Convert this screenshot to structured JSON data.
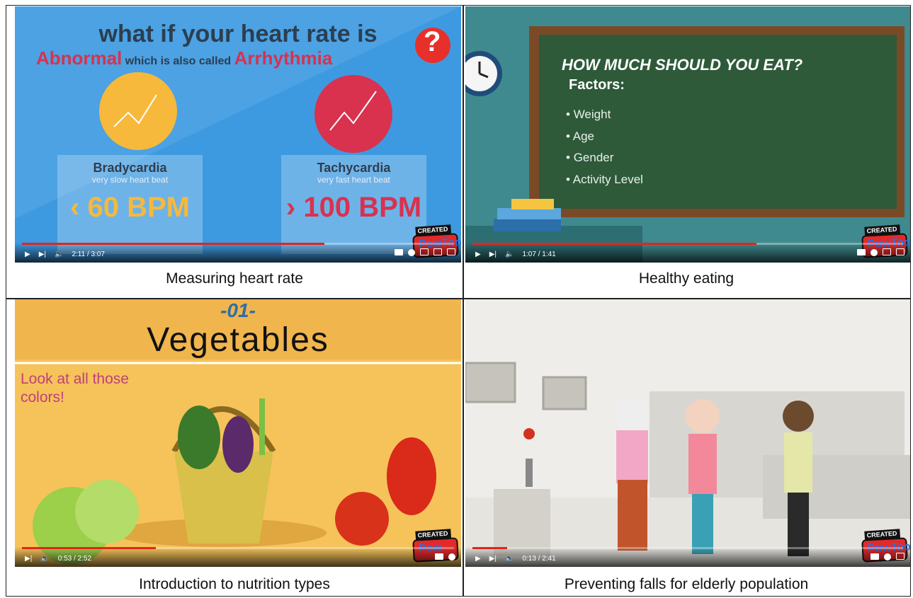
{
  "panels": [
    {
      "caption": "Measuring heart rate",
      "title_line1": "what if your heart rate is",
      "title_red1": "Abnormal",
      "title_mid": "which is also called",
      "title_red2": "Arrhythmia",
      "left_name": "Bradycardia",
      "left_desc": "very slow heart beat",
      "left_value": "‹ 60 BPM",
      "right_name": "Tachycardia",
      "right_desc": "very fast heart beat",
      "right_value": "› 100 BPM",
      "question": "?",
      "time": "2:11 / 3:07",
      "progress": 0.7,
      "watermark_top": "CREATED USING",
      "watermark_logo": "PowToon"
    },
    {
      "caption": "Healthy eating",
      "board_title": "HOW MUCH SHOULD YOU EAT?",
      "board_sub": "Factors:",
      "items": [
        "Weight",
        "Age",
        "Gender",
        "Activity Level"
      ],
      "time": "1:07 / 1:41",
      "progress": 0.66,
      "watermark_top": "CREATED USING",
      "watermark_logo": "PowToon"
    },
    {
      "caption": "Introduction to nutrition types",
      "number": "-01-",
      "heading": "Vegetables",
      "side_note": "Look at all those colors!",
      "time": "0:53 / 2:52",
      "progress": 0.31,
      "watermark_top": "CREATED US",
      "watermark_logo": "Pow"
    },
    {
      "caption": "Preventing falls for elderly population",
      "time": "0:13 / 2:41",
      "progress": 0.08,
      "watermark_top": "CREATED USING",
      "watermark_logo": "PowToon"
    }
  ],
  "colors": {
    "red": "#e0261c",
    "blue_bg": "#3e9ae0",
    "chalkboard": "#2e5a3a",
    "orange_bg": "#f0b54d"
  }
}
